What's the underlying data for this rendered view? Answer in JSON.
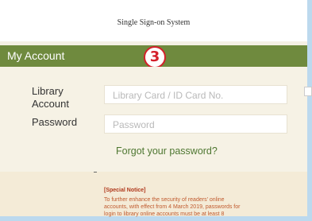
{
  "header": {
    "title": "Single Sign-on System"
  },
  "account": {
    "title": "My Account",
    "step_badge": "3"
  },
  "form": {
    "library_account_label_line1": "Library",
    "library_account_label_line2": "Account",
    "library_account_placeholder": "Library Card / ID Card No.",
    "password_label": "Password",
    "password_placeholder": "Password",
    "forgot_link": "Forgot your password?"
  },
  "notice": {
    "title": "[Special Notice]",
    "lines": [
      "To further enhance the security of readers' online",
      "accounts, with effect from 4 March 2019, passwords for",
      "login to library online accounts must be at least 8"
    ]
  },
  "colors": {
    "account_bar": "#6f8a3e",
    "badge": "#d4202a",
    "link": "#4e7731",
    "notice_text": "#c05a2e",
    "frame_border": "#bcd9ee"
  }
}
